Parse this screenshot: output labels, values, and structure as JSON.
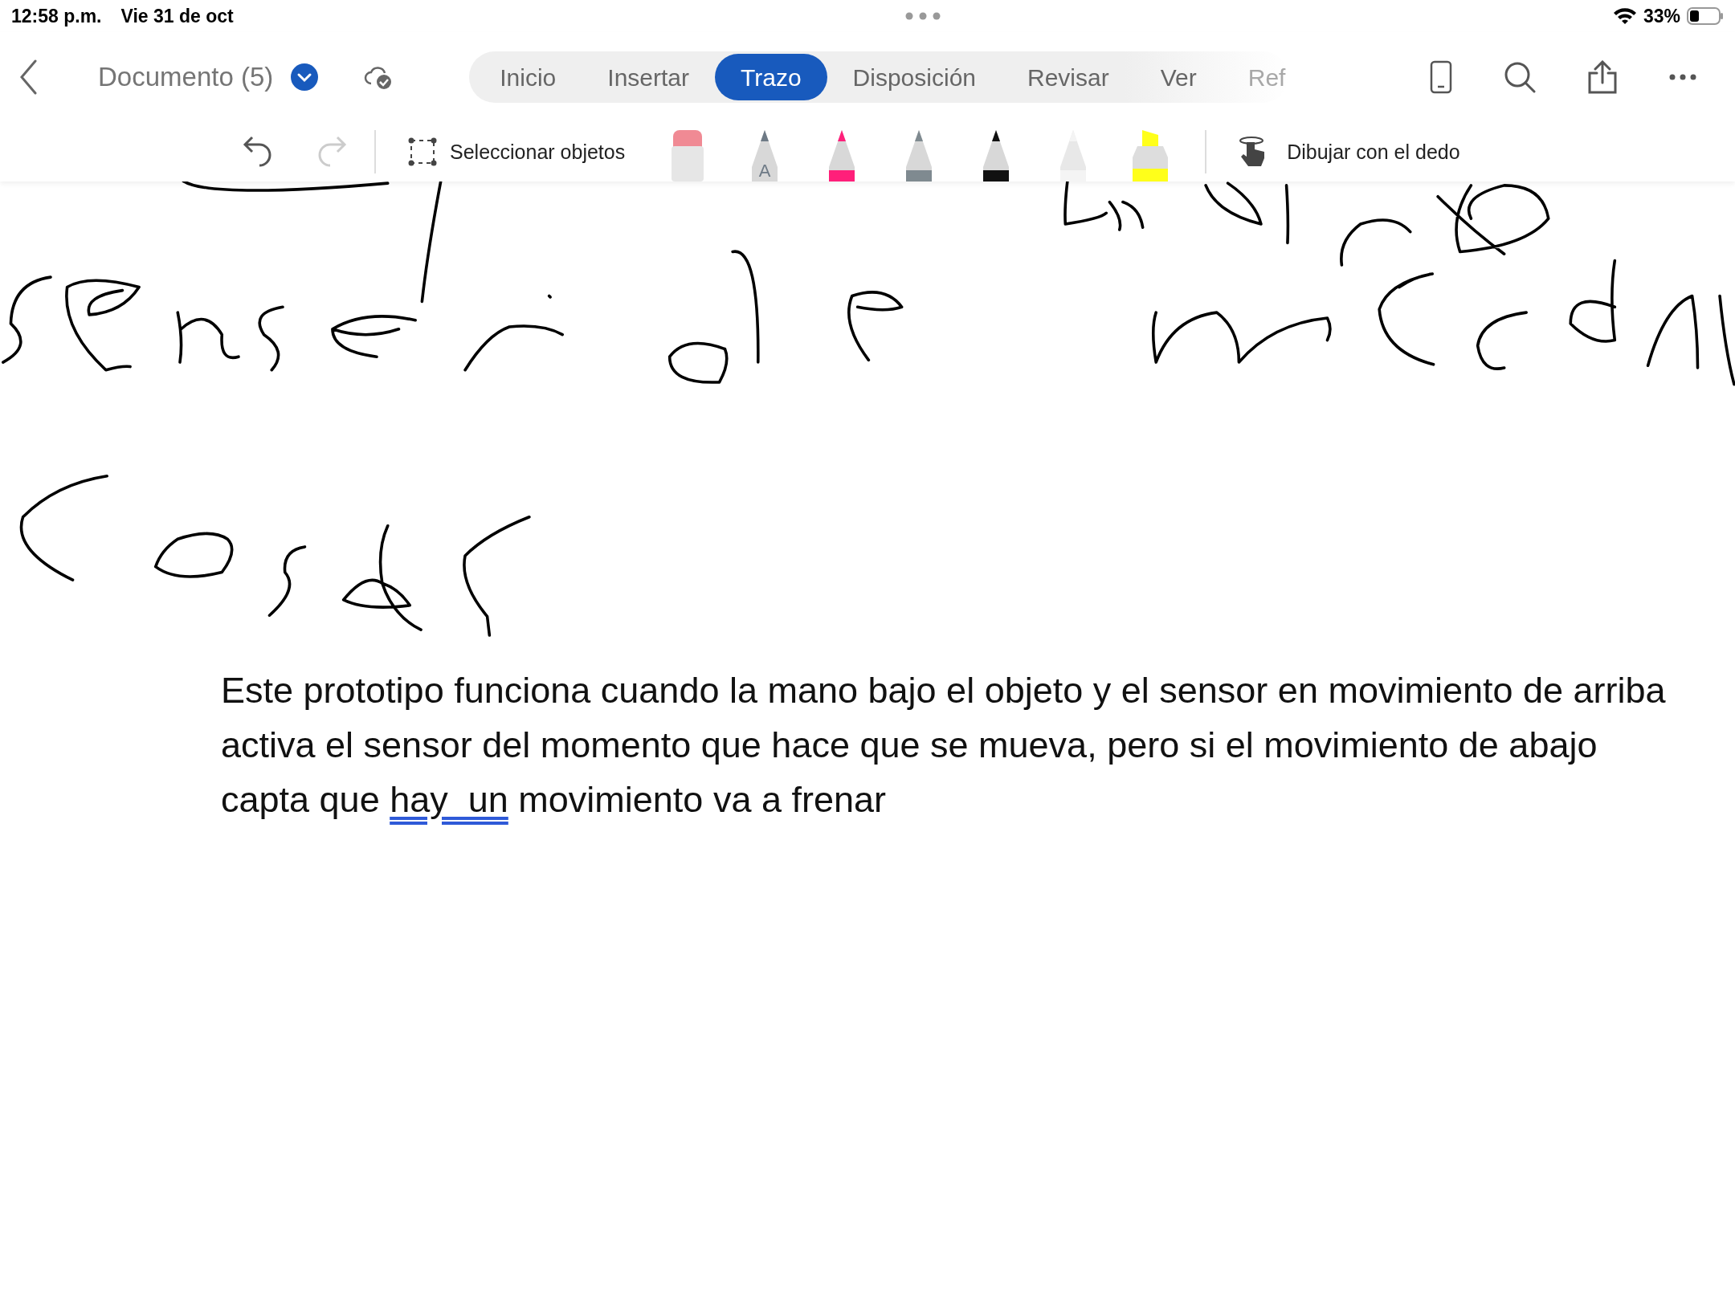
{
  "status_bar": {
    "time": "12:58 p.m.",
    "date": "Vie 31 de oct",
    "battery": "33%"
  },
  "document": {
    "title": "Documento (5)"
  },
  "tabs": [
    {
      "label": "Inicio",
      "selected": false
    },
    {
      "label": "Insertar",
      "selected": false
    },
    {
      "label": "Trazo",
      "selected": true
    },
    {
      "label": "Disposición",
      "selected": false
    },
    {
      "label": "Revisar",
      "selected": false
    },
    {
      "label": "Ver",
      "selected": false
    },
    {
      "label": "Ref",
      "selected": false,
      "faded": true
    }
  ],
  "toolbar": {
    "select": "Seleccionar objetos",
    "finger": "Dibujar con el dedo"
  },
  "pens": [
    {
      "kind": "eraser",
      "color": "#f08a94"
    },
    {
      "kind": "ink-to-text",
      "color": "#6e7a86",
      "label": "A"
    },
    {
      "kind": "pen",
      "color": "#ff1f7a"
    },
    {
      "kind": "pen",
      "color": "#7f8a90"
    },
    {
      "kind": "pen",
      "color": "#111111"
    },
    {
      "kind": "pencil",
      "color": "#f4f4f4"
    },
    {
      "kind": "highlighter",
      "color": "#ffff1a"
    }
  ],
  "paragraph": [
    {
      "text": "Este prototipo funciona cuando la mano bajo el objeto y el sensor en movimiento de arriba activa el sensor del momento que hace que se mueva, pero si el movimiento de abajo capta que ",
      "flagged": false
    },
    {
      "text": "hay  un",
      "flagged": true
    },
    {
      "text": " movimiento va a frenar",
      "flagged": false
    }
  ]
}
